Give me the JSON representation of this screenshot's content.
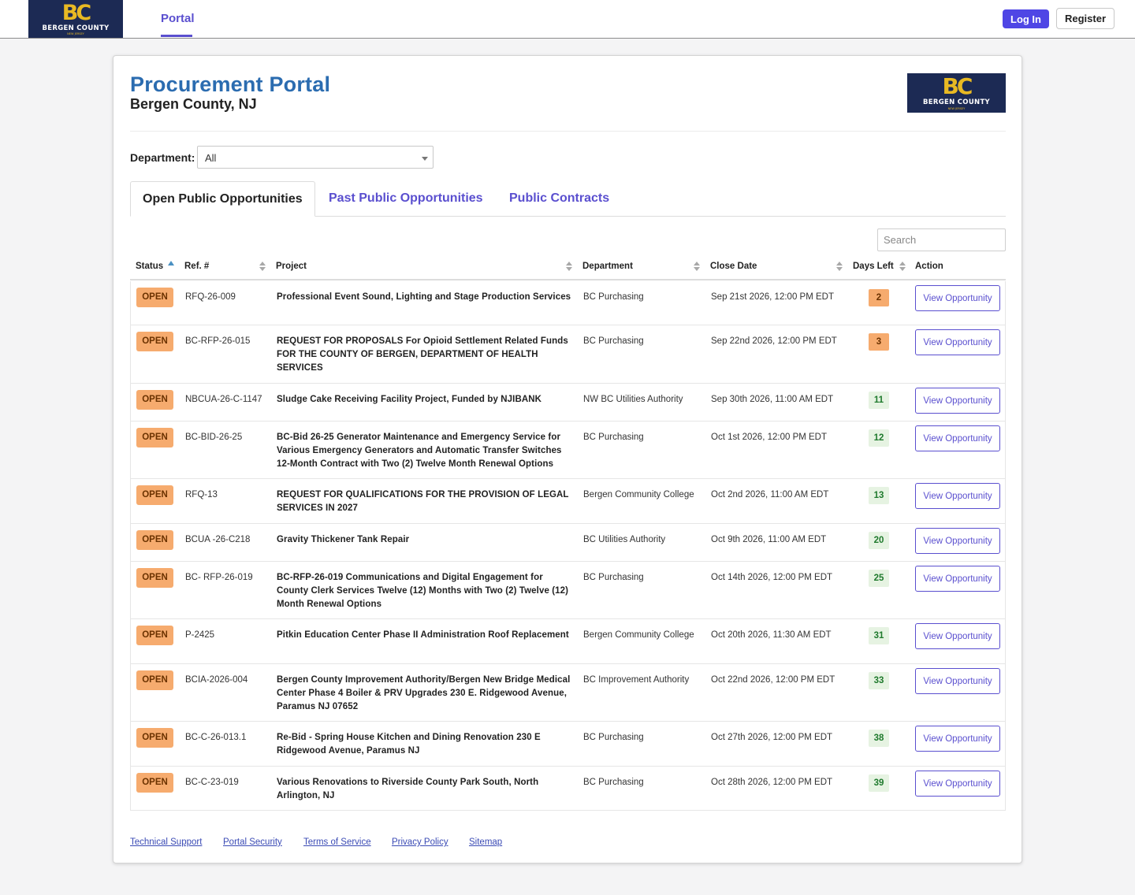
{
  "nav": {
    "logo": {
      "mark": "BC",
      "name": "BERGEN COUNTY",
      "sub": "NEW JERSEY"
    },
    "tab": "Portal",
    "login_label": "Log In",
    "register_label": "Register"
  },
  "header": {
    "title": "Procurement Portal",
    "subtitle": "Bergen County, NJ"
  },
  "filter": {
    "label": "Department:",
    "selected": "All"
  },
  "tabs": [
    {
      "label": "Open Public Opportunities",
      "active": true
    },
    {
      "label": "Past Public Opportunities",
      "active": false
    },
    {
      "label": "Public Contracts",
      "active": false
    }
  ],
  "search": {
    "placeholder": "Search"
  },
  "columns": [
    "Status",
    "Ref. #",
    "Project",
    "Department",
    "Close Date",
    "Days Left",
    "Action"
  ],
  "status_label": "OPEN",
  "action_label": "View Opportunity",
  "rows": [
    {
      "ref": "RFQ-26-009",
      "project": "Professional Event Sound, Lighting and Stage Production Services",
      "department": "BC Purchasing",
      "close": "Sep 21st 2026, 12:00 PM EDT",
      "days": "2"
    },
    {
      "ref": "BC-RFP-26-015",
      "project": "REQUEST FOR PROPOSALS For Opioid Settlement Related Funds FOR THE COUNTY OF BERGEN, DEPARTMENT OF HEALTH SERVICES",
      "department": "BC Purchasing",
      "close": "Sep 22nd 2026, 12:00 PM EDT",
      "days": "3"
    },
    {
      "ref": "NBCUA-26-C-1147",
      "project": "Sludge Cake Receiving Facility Project, Funded by NJIBANK",
      "department": "NW BC Utilities Authority",
      "close": "Sep 30th 2026, 11:00 AM EDT",
      "days": "11"
    },
    {
      "ref": "BC-BID-26-25",
      "project": "BC-Bid 26-25 Generator Maintenance and Emergency Service for Various Emergency Generators and Automatic Transfer Switches 12-Month Contract with Two (2) Twelve Month Renewal Options",
      "department": "BC Purchasing",
      "close": "Oct 1st 2026, 12:00 PM EDT",
      "days": "12"
    },
    {
      "ref": "RFQ-13",
      "project": "REQUEST FOR QUALIFICATIONS FOR THE PROVISION OF LEGAL SERVICES IN 2027",
      "department": "Bergen Community College",
      "close": "Oct 2nd 2026, 11:00 AM EDT",
      "days": "13"
    },
    {
      "ref": "BCUA -26-C218",
      "project": "Gravity Thickener Tank Repair",
      "department": "BC Utilities Authority",
      "close": "Oct 9th 2026, 11:00 AM EDT",
      "days": "20"
    },
    {
      "ref": "BC- RFP-26-019",
      "project": "BC-RFP-26-019 Communications and Digital Engagement for County Clerk Services Twelve (12) Months with Two (2) Twelve (12) Month Renewal Options",
      "department": "BC Purchasing",
      "close": "Oct 14th 2026, 12:00 PM EDT",
      "days": "25"
    },
    {
      "ref": "P-2425",
      "project": "Pitkin Education Center Phase II Administration Roof Replacement",
      "department": "Bergen Community College",
      "close": "Oct 20th 2026, 11:30 AM EDT",
      "days": "31"
    },
    {
      "ref": "BCIA-2026-004",
      "project": "Bergen County Improvement Authority/Bergen New Bridge Medical Center Phase 4 Boiler & PRV Upgrades 230 E. Ridgewood Avenue, Paramus NJ 07652",
      "department": "BC Improvement Authority",
      "close": "Oct 22nd 2026, 12:00 PM EDT",
      "days": "33"
    },
    {
      "ref": "BC-C-26-013.1",
      "project": "Re-Bid - Spring House Kitchen and Dining Renovation 230 E Ridgewood Avenue, Paramus NJ",
      "department": "BC Purchasing",
      "close": "Oct 27th 2026, 12:00 PM EDT",
      "days": "38"
    },
    {
      "ref": "BC-C-23-019",
      "project": "Various Renovations to Riverside County Park South, North Arlington, NJ",
      "department": "BC Purchasing",
      "close": "Oct 28th 2026, 12:00 PM EDT",
      "days": "39"
    }
  ],
  "footer": [
    "Technical Support",
    "Portal Security",
    "Terms of Service",
    "Privacy Policy",
    "Sitemap"
  ],
  "colors": {
    "brand_navy": "#1c2a54",
    "brand_gold": "#e8b923",
    "accent": "#5a4fcf",
    "title_blue": "#2b6cb0",
    "open_badge": "#f6ab6e",
    "days_ok": "#e6f3e2"
  }
}
